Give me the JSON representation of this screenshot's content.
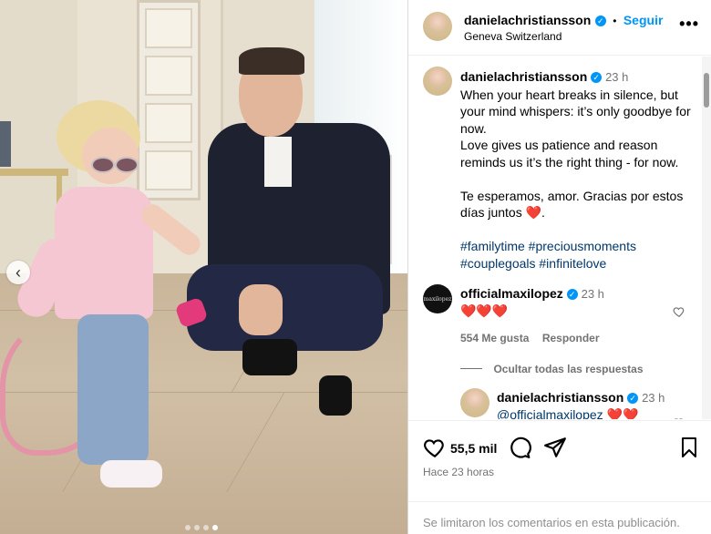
{
  "post": {
    "author": "danielachristiansson",
    "follow_label": "Seguir",
    "separator": "•",
    "location": "Geneva Switzerland",
    "more_icon": "more-horizontal-icon",
    "verified_glyph": "✓"
  },
  "caption": {
    "username": "danielachristiansson",
    "time": "23 h",
    "text_lines": [
      "When your heart breaks in silence, but your mind whispers: it’s only goodbye for now.",
      "Love gives us patience and reason reminds us it’s the right thing - for now.",
      "",
      "Te esperamos, amor. Gracias por estos días juntos"
    ],
    "heart": "❤️",
    "hashtags_line1": "#familytime #preciousmoments",
    "hashtags_line2": "#couplegoals #infinitelove"
  },
  "comment": {
    "username": "officialmaxilopez",
    "time": "23 h",
    "text": "❤️❤️❤️",
    "likes": "554 Me gusta",
    "reply_label": "Responder",
    "hide_replies": "Ocultar todas las respuestas",
    "avatar_text": "maxilopez"
  },
  "reply": {
    "username": "danielachristiansson",
    "time": "23 h",
    "mention": "@officialmaxilopez",
    "text": "❤️❤️"
  },
  "actions": {
    "likes_count": "55,5 mil",
    "time_ago": "Hace 23 horas",
    "comments_limited": "Se limitaron los comentarios en esta publicación.",
    "prev_glyph": "‹"
  },
  "carousel": {
    "dots": 4,
    "active_index": 3
  },
  "colors": {
    "accent": "#0095f6",
    "link": "#00376b",
    "heart": "#e0245e",
    "muted": "#737373"
  }
}
